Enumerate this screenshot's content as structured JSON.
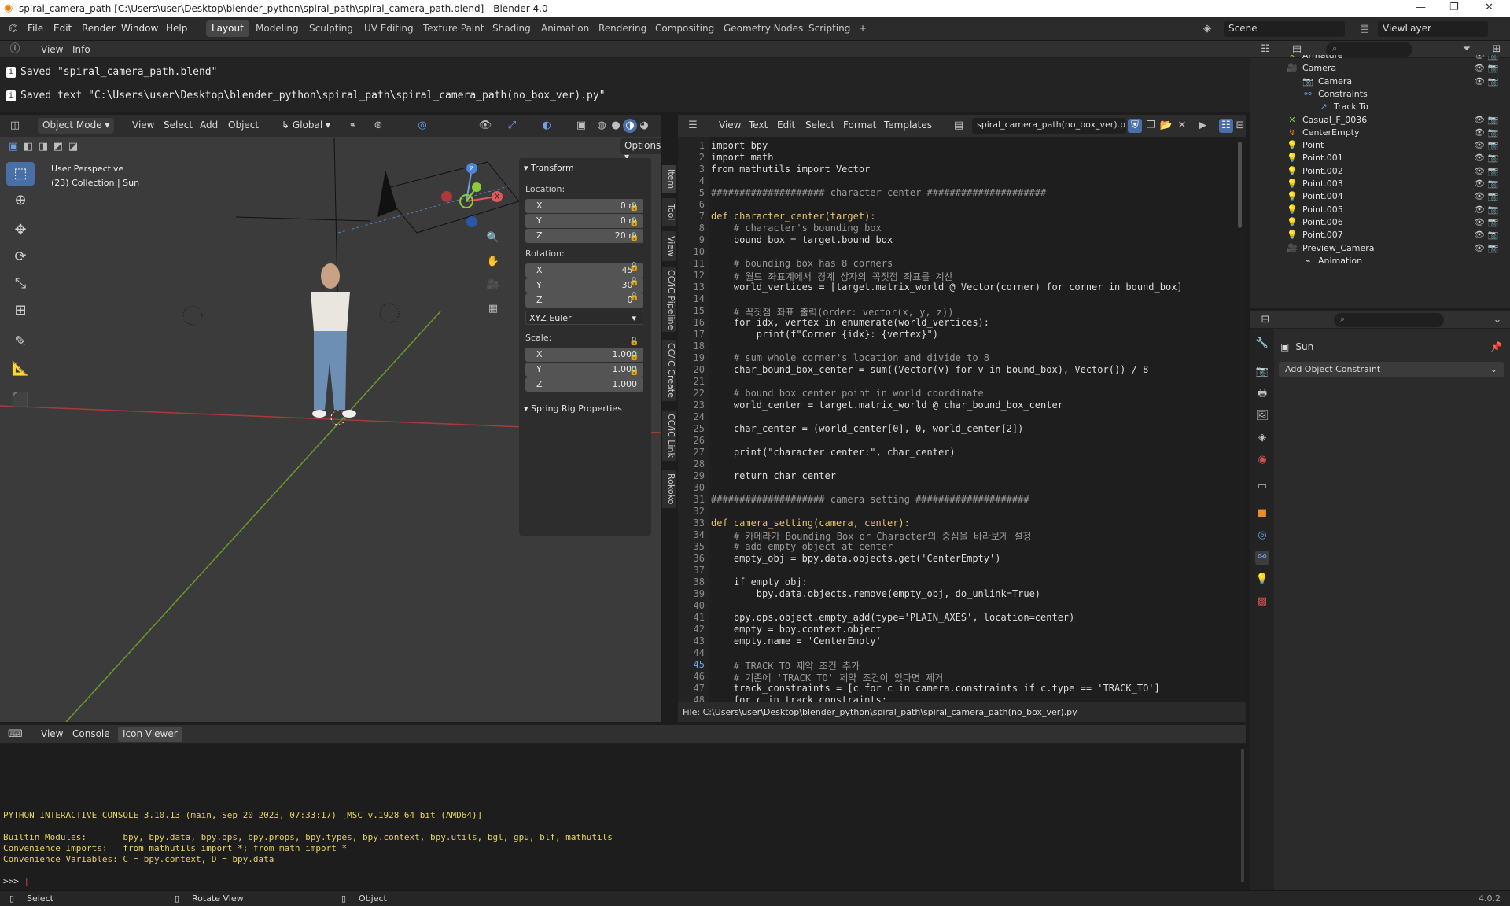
{
  "titlebar": {
    "title": "spiral_camera_path [C:\\Users\\user\\Desktop\\blender_python\\spiral_path\\spiral_camera_path.blend] - Blender 4.0"
  },
  "menu": {
    "items": [
      "File",
      "Edit",
      "Render",
      "Window",
      "Help"
    ]
  },
  "workspaces": {
    "tabs": [
      "Layout",
      "Modeling",
      "Sculpting",
      "UV Editing",
      "Texture Paint",
      "Shading",
      "Animation",
      "Rendering",
      "Compositing",
      "Geometry Nodes",
      "Scripting"
    ],
    "active": "Layout",
    "scene": "Scene",
    "view_layer": "ViewLayer"
  },
  "info": {
    "menu": [
      "View",
      "Info"
    ],
    "log": [
      "Saved \"spiral_camera_path.blend\"",
      "Saved text \"C:\\Users\\user\\Desktop\\blender_python\\spiral_path\\spiral_camera_path(no_box_ver).py\""
    ]
  },
  "viewport": {
    "mode": "Object Mode",
    "menus": [
      "View",
      "Select",
      "Add",
      "Object"
    ],
    "orientation": "Global",
    "options": "Options",
    "overlay_title": "User Perspective",
    "overlay_sub": "(23) Collection | Sun"
  },
  "npanel": {
    "transform": "Transform",
    "location_label": "Location:",
    "location": [
      {
        "k": "X",
        "v": "0 m"
      },
      {
        "k": "Y",
        "v": "0 m"
      },
      {
        "k": "Z",
        "v": "20 m"
      }
    ],
    "rotation_label": "Rotation:",
    "rotation": [
      {
        "k": "X",
        "v": "45°"
      },
      {
        "k": "Y",
        "v": "30°"
      },
      {
        "k": "Z",
        "v": "0°"
      }
    ],
    "rotation_mode": "XYZ Euler",
    "scale_label": "Scale:",
    "scale": [
      {
        "k": "X",
        "v": "1.000"
      },
      {
        "k": "Y",
        "v": "1.000"
      },
      {
        "k": "Z",
        "v": "1.000"
      }
    ],
    "spring": "Spring Rig Properties",
    "tabs": [
      "Item",
      "Tool",
      "View",
      "CC/iC Pipeline",
      "CC/iC Create",
      "CC/iC Link",
      "Rokoko"
    ]
  },
  "editor": {
    "menus": [
      "View",
      "Text",
      "Edit",
      "Select",
      "Format",
      "Templates"
    ],
    "filename": "spiral_camera_path(no_box_ver).py",
    "footer": "File: C:\\Users\\user\\Desktop\\blender_python\\spiral_path\\spiral_camera_path(no_box_ver).py",
    "current_line": 45,
    "lines": [
      "import bpy",
      "import math",
      "from mathutils import Vector",
      "",
      "#################### character center #####################",
      "",
      "def character_center(target):",
      "    # character's bounding box",
      "    bound_box = target.bound_box",
      "",
      "    # bounding box has 8 corners",
      "    # 월드 좌표계에서 경계 상자의 꼭짓점 좌표를 계산",
      "    world_vertices = [target.matrix_world @ Vector(corner) for corner in bound_box]",
      "",
      "    # 꼭짓점 좌표 출력(order: vector(x, y, z))",
      "    for idx, vertex in enumerate(world_vertices):",
      "        print(f\"Corner {idx}: {vertex}\")",
      "",
      "    # sum whole corner's location and divide to 8",
      "    char_bound_box_center = sum((Vector(v) for v in bound_box), Vector()) / 8",
      "",
      "    # bound box center point in world coordinate",
      "    world_center = target.matrix_world @ char_bound_box_center",
      "",
      "    char_center = (world_center[0], 0, world_center[2])",
      "",
      "    print(\"character center:\", char_center)",
      "",
      "    return char_center",
      "",
      "#################### camera setting ####################",
      "",
      "def camera_setting(camera, center):",
      "    # 카메라가 Bounding Box or Character의 중심을 바라보게 설정",
      "    # add empty object at center",
      "    empty_obj = bpy.data.objects.get('CenterEmpty')",
      "",
      "    if empty_obj:",
      "        bpy.data.objects.remove(empty_obj, do_unlink=True)",
      "",
      "    bpy.ops.object.empty_add(type='PLAIN_AXES', location=center)",
      "    empty = bpy.context.object",
      "    empty.name = 'CenterEmpty'",
      "",
      "    # TRACK TO 제약 조건 추가",
      "    # 기존에 'TRACK_TO' 제약 조건이 있다면 제거",
      "    track_constraints = [c for c in camera.constraints if c.type == 'TRACK_TO']",
      "    for c in track_constraints:"
    ]
  },
  "outliner": {
    "items": [
      {
        "name": "Armature",
        "indent": 0,
        "icon": "armature-icon"
      },
      {
        "name": "Camera",
        "indent": 0,
        "icon": "camera-icon"
      },
      {
        "name": "Camera",
        "indent": 1,
        "icon": "camera-data-icon"
      },
      {
        "name": "Constraints",
        "indent": 1,
        "icon": "constraint-icon"
      },
      {
        "name": "Track To",
        "indent": 2,
        "icon": "track-icon"
      },
      {
        "name": "Casual_F_0036",
        "indent": 0,
        "icon": "armature-icon"
      },
      {
        "name": "CenterEmpty",
        "indent": 0,
        "icon": "empty-icon"
      },
      {
        "name": "Point",
        "indent": 0,
        "icon": "light-icon"
      },
      {
        "name": "Point.001",
        "indent": 0,
        "icon": "light-icon"
      },
      {
        "name": "Point.002",
        "indent": 0,
        "icon": "light-icon"
      },
      {
        "name": "Point.003",
        "indent": 0,
        "icon": "light-icon"
      },
      {
        "name": "Point.004",
        "indent": 0,
        "icon": "light-icon"
      },
      {
        "name": "Point.005",
        "indent": 0,
        "icon": "light-icon"
      },
      {
        "name": "Point.006",
        "indent": 0,
        "icon": "light-icon"
      },
      {
        "name": "Point.007",
        "indent": 0,
        "icon": "light-icon"
      },
      {
        "name": "Preview_Camera",
        "indent": 0,
        "icon": "camera-icon"
      },
      {
        "name": "Animation",
        "indent": 1,
        "icon": "animation-icon"
      }
    ]
  },
  "properties": {
    "object": "Sun",
    "add_constraint": "Add Object Constraint"
  },
  "console": {
    "tabs": [
      "View",
      "Console",
      "Icon Viewer"
    ],
    "active": "Icon Viewer",
    "lines": [
      "PYTHON INTERACTIVE CONSOLE 3.10.13 (main, Sep 20 2023, 07:33:17) [MSC v.1928 64 bit (AMD64)]",
      "",
      "Builtin Modules:       bpy, bpy.data, bpy.ops, bpy.props, bpy.types, bpy.context, bpy.utils, bgl, gpu, blf, mathutils",
      "Convenience Imports:   from mathutils import *; from math import *",
      "Convenience Variables: C = bpy.context, D = bpy.data"
    ],
    "prompt": ">>> "
  },
  "status": {
    "select": "Select",
    "rotate": "Rotate View",
    "object": "Object",
    "version": "4.0.2"
  },
  "colors": {
    "accent": "#4a6ea8",
    "grid_x": "#a83a3a",
    "grid_y": "#6a9a2a"
  }
}
